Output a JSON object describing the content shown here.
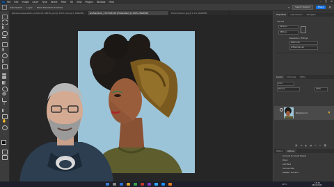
{
  "app": {
    "logo": "Ps"
  },
  "menu": {
    "items": [
      "File",
      "Edit",
      "Image",
      "Layer",
      "Type",
      "Select",
      "Filter",
      "3D",
      "View",
      "Plugins",
      "Window",
      "Help"
    ]
  },
  "options_bar": {
    "items": [
      "Auto-Select:",
      "Layer",
      "Show Transform Controls"
    ],
    "share_label": "Share",
    "search_label": "Select Subject"
  },
  "document_tabs": [
    {
      "label": "Remote-explanation-portrait-01-06525_psd @ 100% (Group 1, RGB/8#)",
      "active": false
    },
    {
      "label": "shutterstock_1727543434 (Embedded) @ 100% (RGB/8#)",
      "active": true
    },
    {
      "label": "Photo-Version.jpg @ 1.1% (RGB/8#)",
      "active": false
    }
  ],
  "properties": {
    "tabs": [
      "Properties",
      "Adjustments",
      "Navigator"
    ],
    "section": "Canvas",
    "w": "4320 px",
    "h": "2880 px",
    "resolution": "Resolution: 300 ppi",
    "mode": "RGB Color",
    "depth": "8 Bits/Channel"
  },
  "layers": {
    "tabs": [
      "Layers",
      "Channels",
      "Paths"
    ],
    "kind": "Kind",
    "blend": "Normal",
    "opacity": "100%",
    "items": [
      {
        "name": "Background",
        "selected": true
      }
    ]
  },
  "history": {
    "tabs": [
      "History",
      "Actions"
    ],
    "items": [
      "Convert to Smart Object",
      "Open",
      "Add Text",
      "Canvas Size",
      "REFINE, OUTPUT"
    ]
  },
  "taskbar": {
    "temperature": "20°C",
    "time": "18:34",
    "date": "28/04/2023"
  },
  "colors": {
    "ui_dark": "#323232",
    "panel": "#383838",
    "accent_blue": "#1473e6",
    "canvas_bg": "#9cc4d8"
  }
}
